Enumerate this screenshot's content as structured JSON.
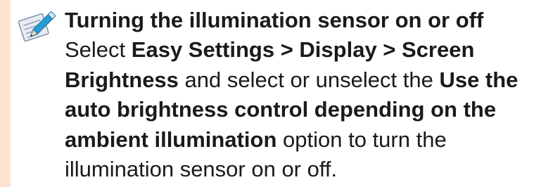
{
  "accent_colors": {
    "side_band": "#fde3cf",
    "icon_note_page": "#e8ecf3",
    "icon_pencil": "#2a9bd6"
  },
  "note": {
    "icon": "note-pencil-icon",
    "title": "Turning the illumination sensor on or off",
    "body": {
      "t1": "Select ",
      "b1": "Easy Settings > Display > Screen Brightness",
      "t2": " and select or unselect the ",
      "b2": "Use the auto brightness control depending on the ambient illumination",
      "t3": " option to turn the illumination sensor on or off."
    }
  }
}
